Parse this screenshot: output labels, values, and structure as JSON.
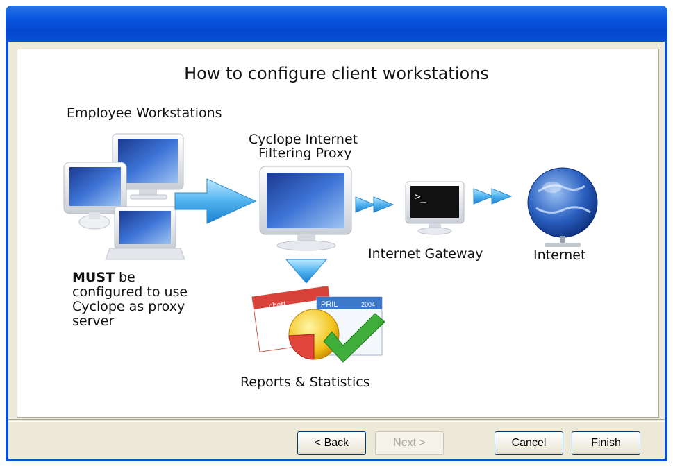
{
  "window": {
    "title": ""
  },
  "diagram": {
    "heading": "How to configure client workstations",
    "employee_label": "Employee Workstations",
    "proxy_label_line1": "Cyclope Internet",
    "proxy_label_line2": "Filtering Proxy",
    "gateway_label": "Internet Gateway",
    "internet_label": "Internet",
    "must_bold": "MUST",
    "must_rest": " be",
    "must_line2": "configured to use",
    "must_line3": "Cyclope as proxy",
    "must_line4": "server",
    "reports_label": "Reports & Statistics",
    "report_doc_text1": "chart",
    "report_doc_text2": "PRIL",
    "report_doc_text3": "2004"
  },
  "buttons": {
    "back": "< Back",
    "next": "Next >",
    "cancel": "Cancel",
    "finish": "Finish"
  }
}
